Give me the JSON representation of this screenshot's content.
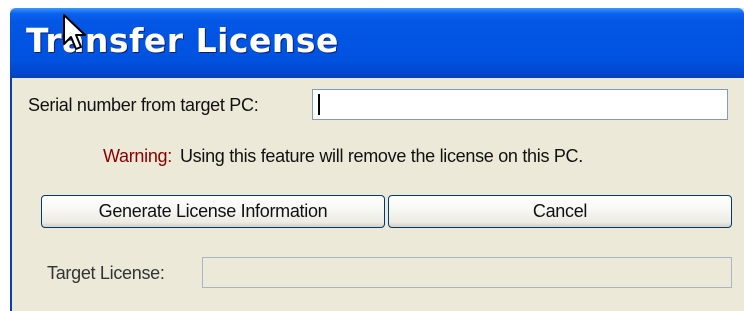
{
  "window": {
    "title": "Transfer License"
  },
  "form": {
    "serial_label": "Serial number from target PC:",
    "serial_value": "",
    "warning_label": "Warning:",
    "warning_text": "Using this feature will remove the license on this PC.",
    "target_label": "Target License:",
    "target_value": ""
  },
  "buttons": {
    "generate_label": "Generate License Information",
    "cancel_label": "Cancel"
  },
  "colors": {
    "titlebar": "#0055e5",
    "dialog_background": "#ece9d8",
    "warning_label": "#8b0000",
    "button_border": "#003c74"
  },
  "icons": {
    "cursor": "mouse-pointer-icon"
  }
}
